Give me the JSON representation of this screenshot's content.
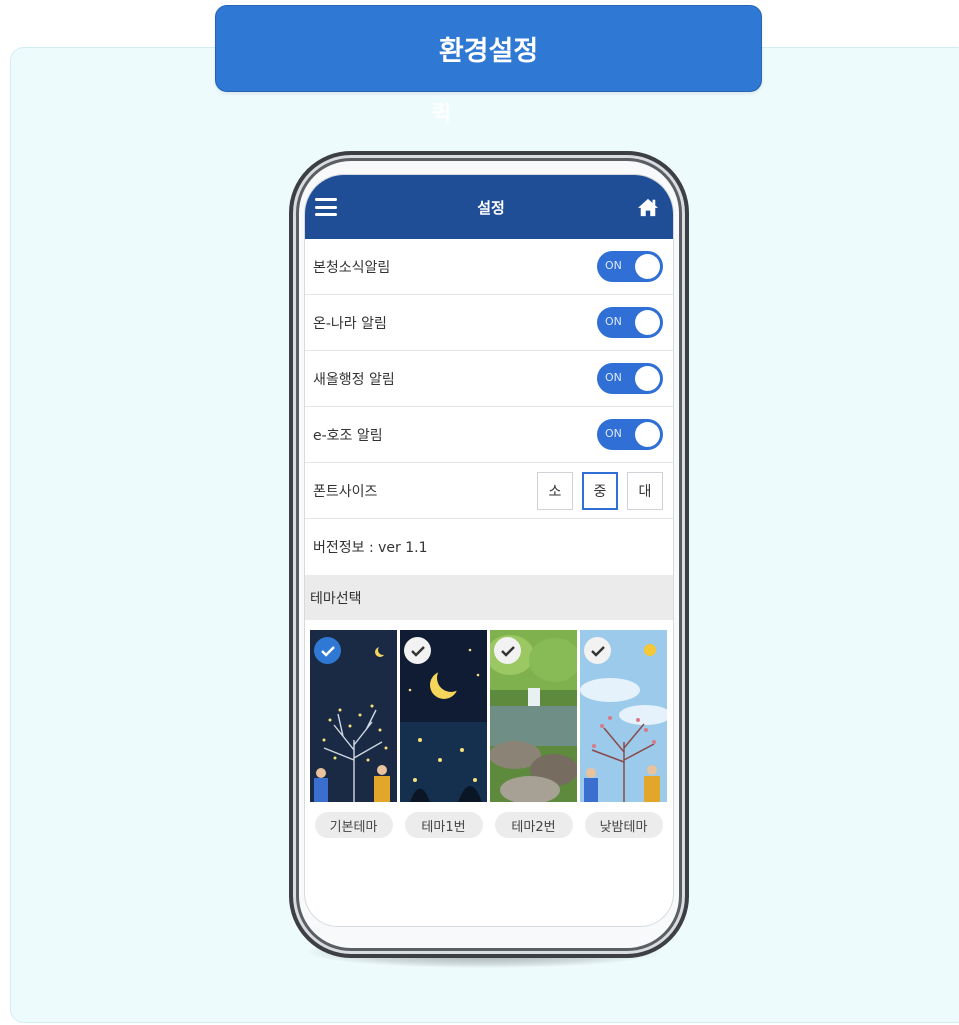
{
  "banner": {
    "title": "환경설정",
    "ghost": "퀵"
  },
  "app": {
    "title": "설정",
    "settings": [
      {
        "label": "본청소식알림",
        "toggle": "ON"
      },
      {
        "label": "온-나라 알림",
        "toggle": "ON"
      },
      {
        "label": "새올행정 알림",
        "toggle": "ON"
      },
      {
        "label": "e-호조 알림",
        "toggle": "ON"
      }
    ],
    "font_size": {
      "label": "폰트사이즈",
      "options": [
        "소",
        "중",
        "대"
      ],
      "selected": "중"
    },
    "version": "버전정보 : ver 1.1",
    "theme_section": "테마선택",
    "themes": [
      {
        "label": "기본테마",
        "selected": true
      },
      {
        "label": "테마1번",
        "selected": false
      },
      {
        "label": "테마2번",
        "selected": false
      },
      {
        "label": "낮밤테마",
        "selected": false
      }
    ]
  },
  "colors": {
    "accent": "#2f78d4",
    "header": "#1f4e97",
    "panel": "#eefbfd"
  }
}
